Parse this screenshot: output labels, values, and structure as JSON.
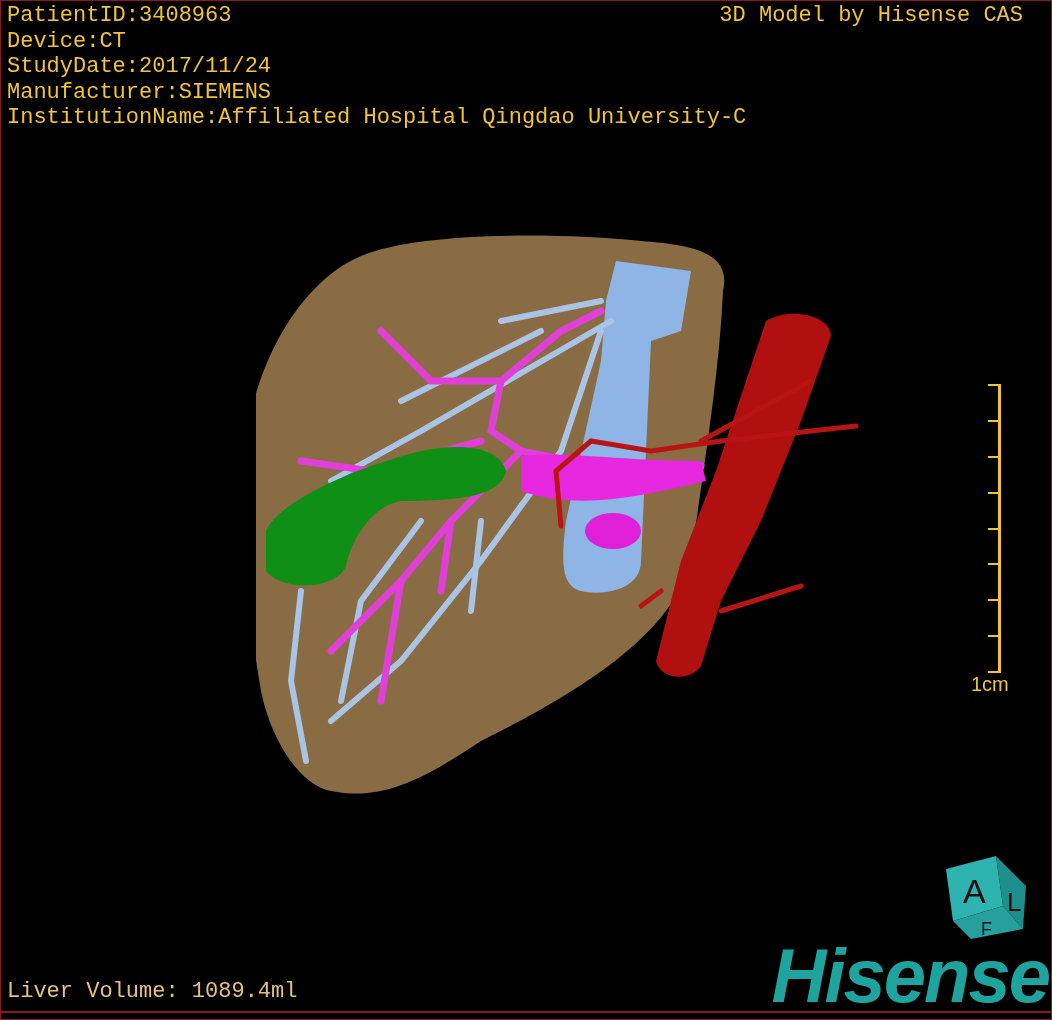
{
  "info_lines": [
    "PatientID:3408963",
    "Device:CT",
    "StudyDate:2017/11/24",
    "Manufacturer:SIEMENS",
    "InstitutionName:Affiliated Hospital Qingdao University-C"
  ],
  "model_credit": "3D Model by Hisense CAS",
  "scale_bar": {
    "label": "1cm"
  },
  "liver_volume": "Liver Volume: 1089.4ml",
  "orientation_cube": {
    "letters": [
      "A",
      "L",
      "F"
    ]
  },
  "logo": {
    "text": "Hisense"
  }
}
